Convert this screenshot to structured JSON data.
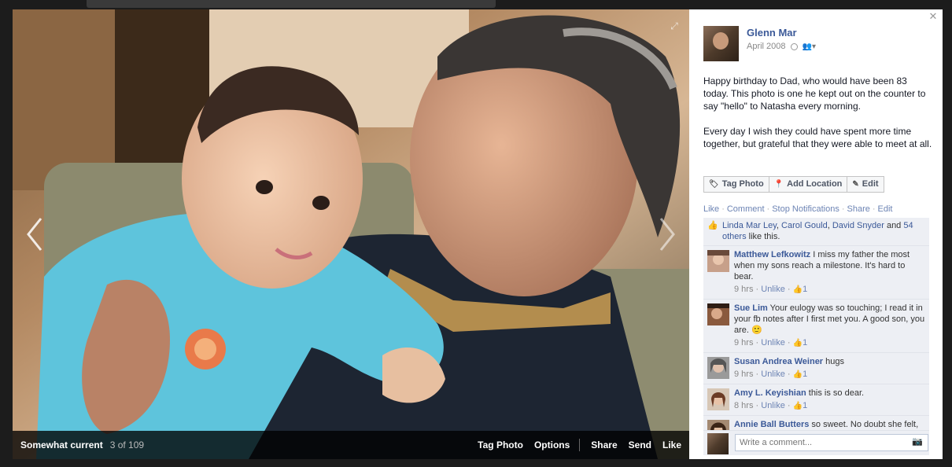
{
  "photo_viewer": {
    "album_name": "Somewhat current",
    "photo_count": "3 of 109",
    "actions": [
      "Tag Photo",
      "Options",
      "Share",
      "Send",
      "Like"
    ]
  },
  "post": {
    "author": "Glenn Mar",
    "date": "April 2008",
    "text": "Happy birthday to Dad, who would have been 83 today. This photo is one he kept out on the counter to say \"hello\" to Natasha every morning.\n\nEvery day I wish they could have spent more time together, but grateful that they were able to meet at all.",
    "buttons": {
      "tag_photo": "Tag Photo",
      "add_location": "Add Location",
      "edit": "Edit"
    },
    "ufi_links": [
      "Like",
      "Comment",
      "Stop Notifications",
      "Share",
      "Edit"
    ],
    "likes": {
      "names": [
        "Linda Mar Ley",
        "Carol Gould",
        "David Snyder"
      ],
      "others": "54 others",
      "suffix": " like this."
    }
  },
  "comments": [
    {
      "author": "Matthew Lefkowitz",
      "text": " I miss my father the most when my sons reach a milestone. It's hard to bear.",
      "time": "9 hrs",
      "action": "Unlike",
      "likes": "1"
    },
    {
      "author": "Sue Lim",
      "text": " Your eulogy was so touching; I read it in your fb notes after I first met you. A good son, you are. 🙂",
      "time": "9 hrs",
      "action": "Unlike",
      "likes": "1"
    },
    {
      "author": "Susan Andrea Weiner",
      "text": " hugs",
      "time": "9 hrs",
      "action": "Unlike",
      "likes": "1"
    },
    {
      "author": "Amy L. Keyishian",
      "text": " this is so dear.",
      "time": "8 hrs",
      "action": "Unlike",
      "likes": "1"
    },
    {
      "author": "Annie Ball Butters",
      "text": " so sweet. No doubt she felt, and continues to feel his love. As I'm sure you do as well. Hugs Glenn.",
      "time": "",
      "action": "",
      "likes": ""
    }
  ],
  "comment_input": {
    "placeholder": "Write a comment..."
  },
  "colors": {
    "link": "#3b5998",
    "light_link": "#6d84b4",
    "comment_bg": "#edeff4"
  },
  "icons": [
    "expand-icon",
    "close-icon",
    "chevron-left-icon",
    "chevron-right-icon",
    "tag-icon",
    "location-pin-icon",
    "pencil-icon",
    "thumbs-up-icon",
    "camera-icon",
    "privacy-icon",
    "audience-icon"
  ]
}
